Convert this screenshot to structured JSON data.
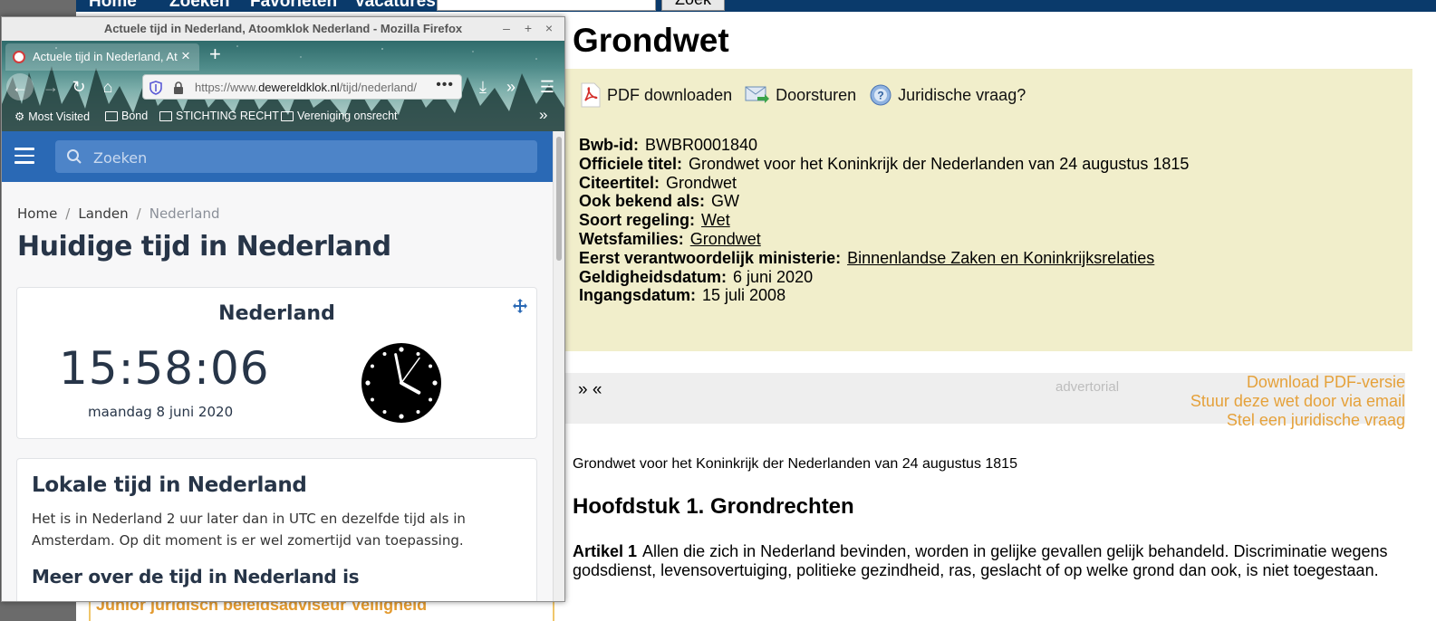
{
  "background_page": {
    "nav": {
      "items": [
        "Home",
        "Zoeken",
        "Favorieten",
        "Vacatures"
      ],
      "search_button": "Zoek"
    },
    "title": "Grondwet",
    "actions": [
      {
        "label": "PDF downloaden",
        "icon": "pdf-icon"
      },
      {
        "label": "Doorsturen",
        "icon": "mail-forward-icon"
      },
      {
        "label": "Juridische vraag?",
        "icon": "question-icon"
      }
    ],
    "meta": [
      {
        "key": "Bwb-id:",
        "value": "BWBR0001840",
        "link": false
      },
      {
        "key": "Officiele titel:",
        "value": "Grondwet voor het Koninkrijk der Nederlanden van 24 augustus 1815",
        "link": false
      },
      {
        "key": "Citeertitel:",
        "value": "Grondwet",
        "link": false
      },
      {
        "key": "Ook bekend als:",
        "value": "GW",
        "link": false
      },
      {
        "key": "Soort regeling:",
        "value": "Wet",
        "link": true
      },
      {
        "key": "Wetsfamilies:",
        "value": "Grondwet",
        "link": true
      },
      {
        "key": "Eerst verantwoordelijk ministerie:",
        "value": "Binnenlandse Zaken en Koninkrijksrelaties",
        "link": true
      },
      {
        "key": "Geldigheidsdatum:",
        "value": "6 juni 2020",
        "link": false
      },
      {
        "key": "Ingangsdatum:",
        "value": "15 juli 2008",
        "link": false
      }
    ],
    "advert": {
      "arrows": "» «",
      "advertorial": "advertorial",
      "links": [
        "Download PDF-versie",
        "Stuur deze wet door via email",
        "Stel een juridische vraag"
      ]
    },
    "full_title": "Grondwet voor het Koninkrijk der Nederlanden van 24 augustus 1815",
    "chapter": "Hoofdstuk 1. Grondrechten",
    "article": {
      "label": "Artikel 1",
      "text": "Allen die zich in Nederland bevinden, worden in gelijke gevallen gelijk behandeld. Discriminatie wegens godsdienst, levensovertuiging, politieke gezindheid, ras, geslacht of op welke grond dan ook, is niet toegestaan."
    },
    "job_link": "Junior juridisch beleidsadviseur Veiligheid"
  },
  "browser": {
    "window_title": "Actuele tijd in Nederland, Atoomklok Nederland - Mozilla Firefox",
    "tab_title": "Actuele tijd in Nederland, Atoomklok Nederland",
    "url_prefix": "https://www.",
    "url_domain": "dewereldklok.nl",
    "url_path": "/tijd/nederland/",
    "bookmarks": [
      {
        "label": "Most Visited",
        "icon": "gear-icon"
      },
      {
        "label": "Bond",
        "icon": "folder-icon"
      },
      {
        "label": "STICHTING RECHT",
        "icon": "folder-icon"
      },
      {
        "label": "Vereniging onsrecht",
        "icon": "folder-icon"
      }
    ]
  },
  "site": {
    "search_placeholder": "Zoeken",
    "breadcrumb": [
      "Home",
      "Landen",
      "Nederland"
    ],
    "heading": "Huidige tijd in Nederland",
    "clock": {
      "country": "Nederland",
      "time": "15:58:06",
      "date": "maandag 8 juni 2020",
      "hour": 15,
      "minute": 58,
      "second": 6
    },
    "local": {
      "heading": "Lokale tijd in Nederland",
      "text": "Het is in Nederland 2 uur later dan in UTC en dezelfde tijd als in Amsterdam. Op dit moment is er wel zomertijd van toepassing.",
      "more_heading": "Meer over de tijd in Nederland is"
    }
  },
  "colors": {
    "site_header": "#2a69b5",
    "meta_box": "#f1eecb",
    "advert_link": "#e5a13a",
    "bg_nav": "#0a3a6b"
  }
}
